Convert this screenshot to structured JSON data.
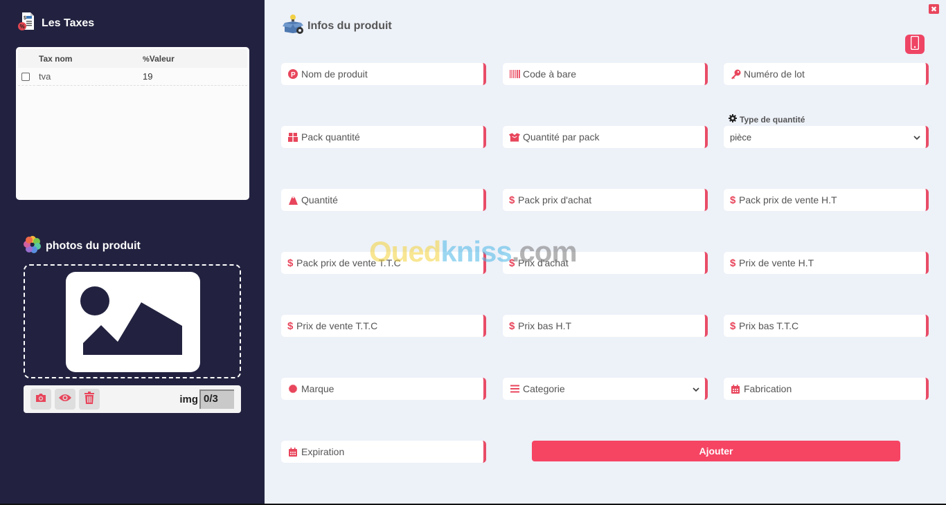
{
  "sidebar": {
    "taxes": {
      "title": "Les Taxes",
      "icon": "tax-document-icon",
      "columns": {
        "name": "Tax nom",
        "value": "Valeur"
      },
      "rows": [
        {
          "name": "tva",
          "value": "19",
          "checked": false
        }
      ]
    },
    "photos": {
      "title": "photos du produit",
      "icon": "photos-flower-icon",
      "placeholder_icon": "image-placeholder-icon",
      "toolbar": {
        "camera_icon": "camera-icon",
        "view_icon": "eye-icon",
        "delete_icon": "trash-icon",
        "img_label": "img",
        "img_count": "0/3"
      }
    }
  },
  "main": {
    "title": "Infos du produit",
    "icon": "product-box-icon",
    "close_icon": "close-icon",
    "mobile_icon": "mobile-phone-icon",
    "accent_color": "#e84c67",
    "fields": {
      "nom_produit": {
        "label": "Nom de produit",
        "icon": "p-circle-icon"
      },
      "code_bare": {
        "label": "Code à bare",
        "icon": "barcode-icon"
      },
      "numero_lot": {
        "label": "Numéro de lot",
        "icon": "key-icon"
      },
      "pack_quantite": {
        "label": "Pack quantité",
        "icon": "gift-box-icon"
      },
      "quantite_par_pack": {
        "label": "Quantité par pack",
        "icon": "open-box-icon"
      },
      "type_quantite": {
        "label": "Type de quantité",
        "icon": "gear-icon",
        "selected": "pièce"
      },
      "quantite": {
        "label": "Quantité",
        "icon": "weight-icon"
      },
      "pack_prix_achat": {
        "label": "Pack prix d'achat",
        "icon": "dollar-icon"
      },
      "pack_prix_vente_ht": {
        "label": "Pack prix de vente H.T",
        "icon": "dollar-icon"
      },
      "pack_prix_vente_ttc": {
        "label": "Pack prix de vente T.T.C",
        "icon": "dollar-icon"
      },
      "prix_achat": {
        "label": "Prix d'achat",
        "icon": "dollar-icon"
      },
      "prix_vente_ht": {
        "label": "Prix de vente H.T",
        "icon": "dollar-icon"
      },
      "prix_vente_ttc": {
        "label": "Prix de vente T.T.C",
        "icon": "dollar-icon"
      },
      "prix_bas_ht": {
        "label": "Prix bas H.T",
        "icon": "dollar-icon"
      },
      "prix_bas_ttc": {
        "label": "Prix bas T.T.C",
        "icon": "dollar-icon"
      },
      "marque": {
        "label": "Marque",
        "icon": "certificate-icon"
      },
      "categorie": {
        "label": "Categorie",
        "icon": "list-icon"
      },
      "fabrication": {
        "label": "Fabrication",
        "icon": "calendar-icon"
      },
      "expiration": {
        "label": "Expiration",
        "icon": "calendar-icon"
      }
    },
    "dollar_symbol": "$",
    "chevron": "⌄",
    "submit_label": "Ajouter"
  },
  "watermark": {
    "part1": "Oued",
    "part2": "kniss",
    "part3": ".com"
  }
}
